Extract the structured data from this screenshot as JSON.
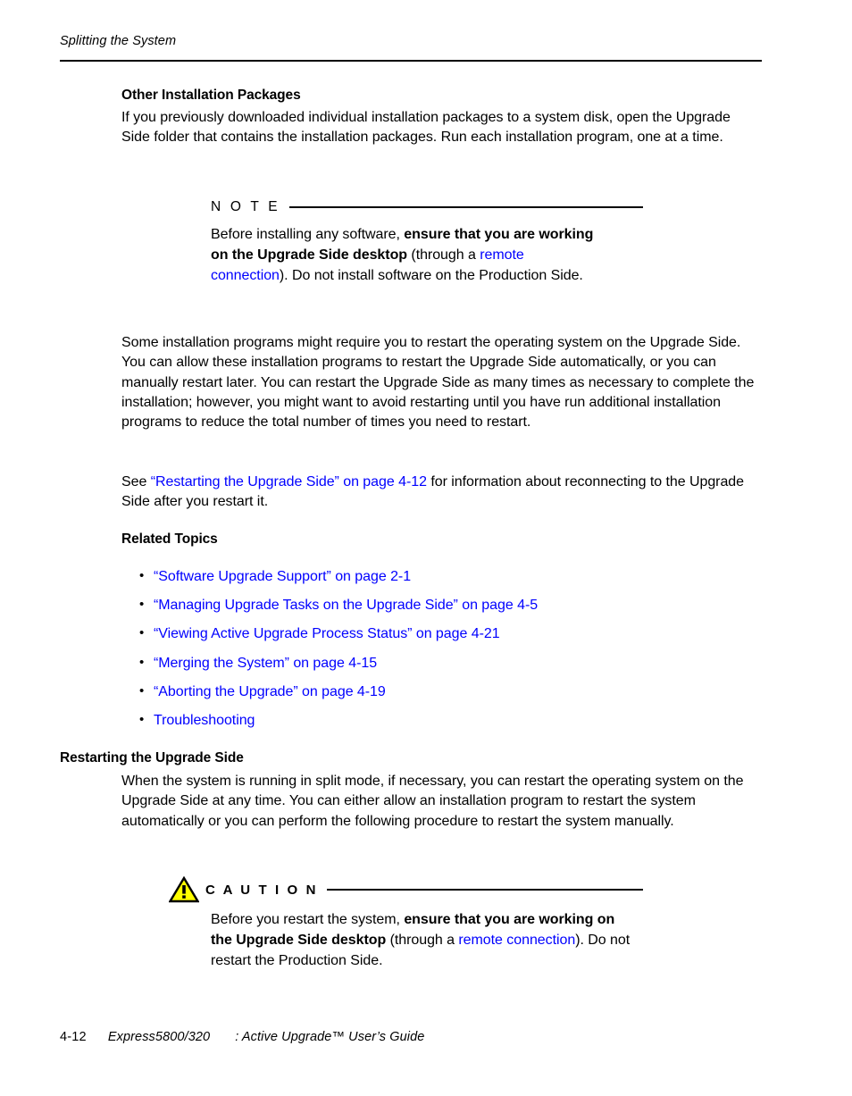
{
  "header": {
    "running_head": "Splitting the System"
  },
  "sections": {
    "other_packages": {
      "heading": "Other Installation Packages",
      "paragraph": "If you previously downloaded individual installation packages to a system disk, open the Upgrade Side folder that contains the installation packages. Run each installation program, one at a time."
    },
    "note": {
      "label": "N O T E",
      "text_1": "Before installing any software, ",
      "bold_1": "ensure that you are working on the Upgrade Side desktop",
      "text_2": " (through a ",
      "link_1": "remote connection",
      "text_3": "). Do not install software on the Production Side."
    },
    "restart_paragraph": "Some installation programs might require you to restart the operating system on the Upgrade Side. You can allow these installation programs to restart the Upgrade Side automatically, or you can manually restart later. You can restart the Upgrade Side as many times as necessary to complete the installation; however, you might want to avoid restarting until you have run additional installation programs to reduce the total number of times you need to restart.",
    "see_paragraph": {
      "text_1": "See ",
      "link": "“Restarting the Upgrade Side” on page 4-12",
      "text_2": " for information about reconnecting to the Upgrade Side after you restart it."
    },
    "related_topics": {
      "heading": "Related Topics",
      "items": [
        "“Software Upgrade Support” on page 2-1",
        "“Managing Upgrade Tasks on the Upgrade Side” on page 4-5",
        "“Viewing Active Upgrade Process Status” on page 4-21",
        "“Merging the System” on page 4-15",
        "“Aborting the Upgrade” on page 4-19",
        "Troubleshooting"
      ]
    },
    "restarting_section": {
      "heading": "Restarting the Upgrade Side",
      "paragraph": "When the system is running in split mode, if necessary, you can restart the operating system on the Upgrade Side at any time. You can either allow an installation program to restart the system automatically or you can perform the following procedure to restart the system manually."
    },
    "caution": {
      "label": "C A U T I O N",
      "icon": "warning-triangle-icon",
      "text_1": "Before you restart the system, ",
      "bold_1": "ensure that you are working on the Upgrade Side desktop",
      "text_2": " (through a ",
      "link_1": "remote connection",
      "text_3": "). Do not restart the Production Side."
    }
  },
  "footer": {
    "page_number": "4-12",
    "product": "Express5800/320",
    "guide_title": ": Active Upgrade™ User’s Guide"
  },
  "colors": {
    "link": "#0000ff",
    "text": "#000000",
    "caution_fill": "#ffff00",
    "rule": "#000000"
  }
}
